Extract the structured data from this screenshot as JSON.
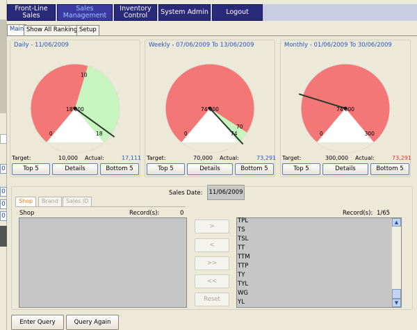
{
  "colors": {
    "nav_bg": "#2a2a7a",
    "red_zone": "#f47777",
    "green_zone": "#c7f5c0",
    "link_blue": "#2d55b5",
    "actual_red": "#e03030"
  },
  "nav": {
    "items": [
      "Front-Line Sales",
      "Sales\nManagement",
      "Inventory\nControl",
      "System Admin",
      "Logout"
    ],
    "active_index": 1
  },
  "tabs": [
    "Main",
    "Show All Ranking",
    "Setup"
  ],
  "edge_numbers": [
    "0",
    "0",
    "0",
    "0"
  ],
  "gauges": [
    {
      "title": "Daily - 11/06/2009",
      "center_value": "18'000",
      "min": "0",
      "max": "18",
      "target_mark": "10",
      "target_label": "Target:",
      "target": "10,000",
      "actual_label": "Actual:",
      "actual": "17,111",
      "actual_color": "#2d55b5",
      "needle_fraction": 0.95,
      "green_from_fraction": 0.56,
      "buttons": [
        "Top 5",
        "Details",
        "Bottom 5"
      ]
    },
    {
      "title": "Weekly - 07/06/2009 To 13/06/2009",
      "center_value": "74'000",
      "min": "0",
      "max": "74",
      "target_mark": "70",
      "target_label": "Target:",
      "target": "70,000",
      "actual_label": "Actual:",
      "actual": "73,291",
      "actual_color": "#2d55b5",
      "needle_fraction": 0.99,
      "green_from_fraction": 0.94,
      "buttons": [
        "Top 5",
        "Details",
        "Bottom 5"
      ]
    },
    {
      "title": "Monthly - 01/06/2009 To 30/06/2009",
      "center_value": "74'000",
      "min": "0",
      "max": "300",
      "target_mark": "",
      "target_label": "Target:",
      "target": "300,000",
      "actual_label": "Actual:",
      "actual": "73,291",
      "actual_color": "#e03030",
      "needle_fraction": 0.24,
      "green_from_fraction": 1.0,
      "buttons": [
        "Top 5",
        "Details",
        "Bottom 5"
      ]
    }
  ],
  "sales_date": {
    "label": "Sales Date:",
    "value": "11/06/2009"
  },
  "sub_tabs": [
    "Shop",
    "Brand",
    "Sales ID"
  ],
  "left_list": {
    "header": "Shop",
    "records_label": "Record(s):",
    "records_value": "0"
  },
  "right_list": {
    "records_label": "Record(s):",
    "records_value": "1/65",
    "items": [
      "TPL",
      "TS",
      "TSL",
      "TT",
      "TTM",
      "TTP",
      "TY",
      "TYL",
      "WG",
      "YL"
    ]
  },
  "move_buttons": [
    ">",
    "<",
    ">>",
    "<<",
    "Reset"
  ],
  "bottom_buttons": [
    "Enter Query",
    "Query Again"
  ]
}
